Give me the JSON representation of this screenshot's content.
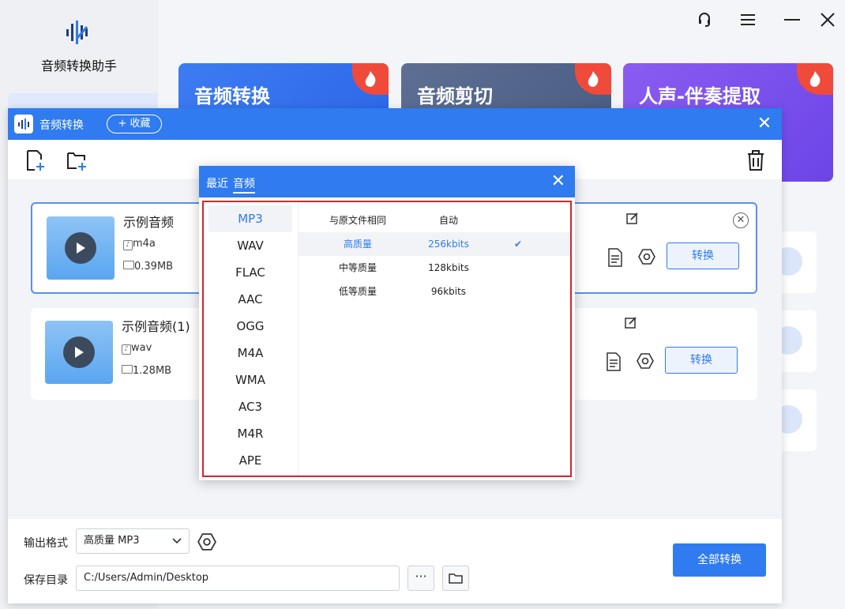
{
  "app": {
    "name": "音频转换助手"
  },
  "window_controls": {
    "support": "headset-icon",
    "menu": "menu-icon",
    "minimize": "minimize-icon",
    "close": "close-icon"
  },
  "cards": [
    {
      "title": "音频转换"
    },
    {
      "title": "音频剪切"
    },
    {
      "title": "人声-伴奏提取"
    }
  ],
  "dialog": {
    "title": "音频转换",
    "favorite_label": "+ 收藏",
    "files": [
      {
        "name": "示例音频",
        "format": "m4a",
        "size": "0.39MB",
        "convert_label": "转换"
      },
      {
        "name": "示例音频(1)",
        "format": "wav",
        "size": "1.28MB",
        "convert_label": "转换"
      }
    ],
    "output_format_label": "输出格式",
    "output_format_value": "高质量 MP3",
    "save_dir_label": "保存目录",
    "save_dir_value": "C:/Users/Admin/Desktop",
    "more_label": "···",
    "convert_all_label": "全部转换"
  },
  "popup": {
    "tabs": [
      "最近",
      "音频"
    ],
    "active_tab": "音频",
    "formats": [
      "MP3",
      "WAV",
      "FLAC",
      "AAC",
      "OGG",
      "M4A",
      "WMA",
      "AC3",
      "M4R",
      "APE"
    ],
    "selected_format": "MP3",
    "qualities": [
      {
        "name": "与原文件相同",
        "rate": "自动",
        "check": ""
      },
      {
        "name": "高质量",
        "rate": "256kbits",
        "check": "✔"
      },
      {
        "name": "中等质量",
        "rate": "128kbits",
        "check": ""
      },
      {
        "name": "低等质量",
        "rate": "96kbits",
        "check": ""
      }
    ],
    "selected_quality": "高质量"
  },
  "colors": {
    "primary": "#2f7bef",
    "highlight_border": "#d8232a",
    "hot_badge": "#ef4a3a"
  }
}
